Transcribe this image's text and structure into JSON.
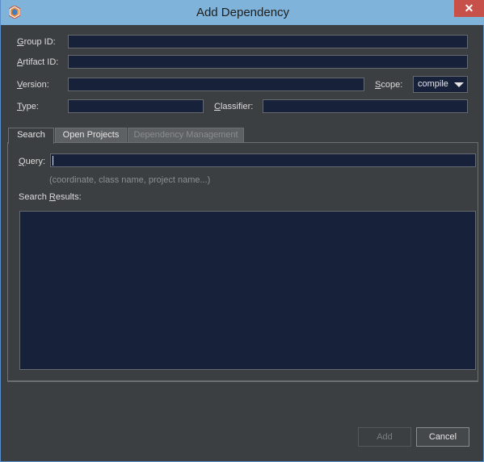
{
  "window": {
    "title": "Add Dependency",
    "close_glyph": "✕"
  },
  "form": {
    "group_id": {
      "mnemonic": "G",
      "rest": "roup ID:",
      "value": ""
    },
    "artifact_id": {
      "mnemonic": "A",
      "rest": "rtifact ID:",
      "value": ""
    },
    "version": {
      "mnemonic": "V",
      "rest": "ersion:",
      "value": ""
    },
    "scope": {
      "mnemonic": "S",
      "rest": "cope:",
      "selected": "compile"
    },
    "type": {
      "mnemonic": "T",
      "rest": "ype:",
      "value": ""
    },
    "classifier": {
      "mnemonic": "C",
      "rest": "lassifier:",
      "value": ""
    }
  },
  "tabs": [
    {
      "label": "Search",
      "state": "active"
    },
    {
      "label": "Open Projects",
      "state": "inactive"
    },
    {
      "label": "Dependency Management",
      "state": "disabled"
    }
  ],
  "search": {
    "query_mnemonic": "Q",
    "query_rest": "uery:",
    "query_value": "",
    "hint": "(coordinate, class name, project name...)",
    "results_pre": "Search ",
    "results_mnemonic": "R",
    "results_rest": "esults:"
  },
  "buttons": {
    "add": "Add",
    "cancel": "Cancel"
  },
  "colors": {
    "titlebar": "#7fb3da",
    "background": "#3c3f41",
    "field": "#17213a",
    "close": "#c7504b"
  }
}
